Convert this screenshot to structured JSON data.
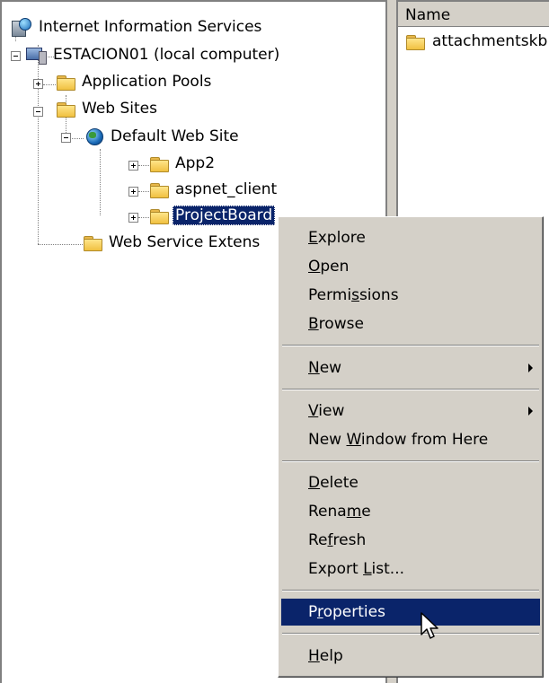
{
  "tree": {
    "root": "Internet Information Services",
    "computer": "ESTACION01 (local computer)",
    "app_pools": "Application Pools",
    "web_sites": "Web Sites",
    "default_site": "Default Web Site",
    "app2": "App2",
    "aspnet_client": "aspnet_client",
    "projectboard": "ProjectBoard",
    "web_service_ext": "Web Service Extens"
  },
  "list": {
    "column_name": "Name",
    "items": [
      "attachmentskb"
    ]
  },
  "menu": {
    "items": [
      {
        "pre": "",
        "u": "E",
        "post": "xplore"
      },
      {
        "pre": "",
        "u": "O",
        "post": "pen"
      },
      {
        "pre": "Permi",
        "u": "s",
        "post": "sions"
      },
      {
        "pre": "",
        "u": "B",
        "post": "rowse"
      },
      {
        "pre": "",
        "u": "N",
        "post": "ew"
      },
      {
        "pre": "",
        "u": "V",
        "post": "iew"
      },
      {
        "pre": "New ",
        "u": "W",
        "post": "indow from Here"
      },
      {
        "pre": "",
        "u": "D",
        "post": "elete"
      },
      {
        "pre": "Rena",
        "u": "m",
        "post": "e"
      },
      {
        "pre": "Re",
        "u": "f",
        "post": "resh"
      },
      {
        "pre": "Export ",
        "u": "L",
        "post": "ist..."
      },
      {
        "pre": "P",
        "u": "r",
        "post": "operties"
      },
      {
        "pre": "",
        "u": "H",
        "post": "elp"
      }
    ],
    "highlighted": "Properties"
  },
  "colors": {
    "selection": "#0a246a",
    "menu_bg": "#d4d0c8"
  }
}
